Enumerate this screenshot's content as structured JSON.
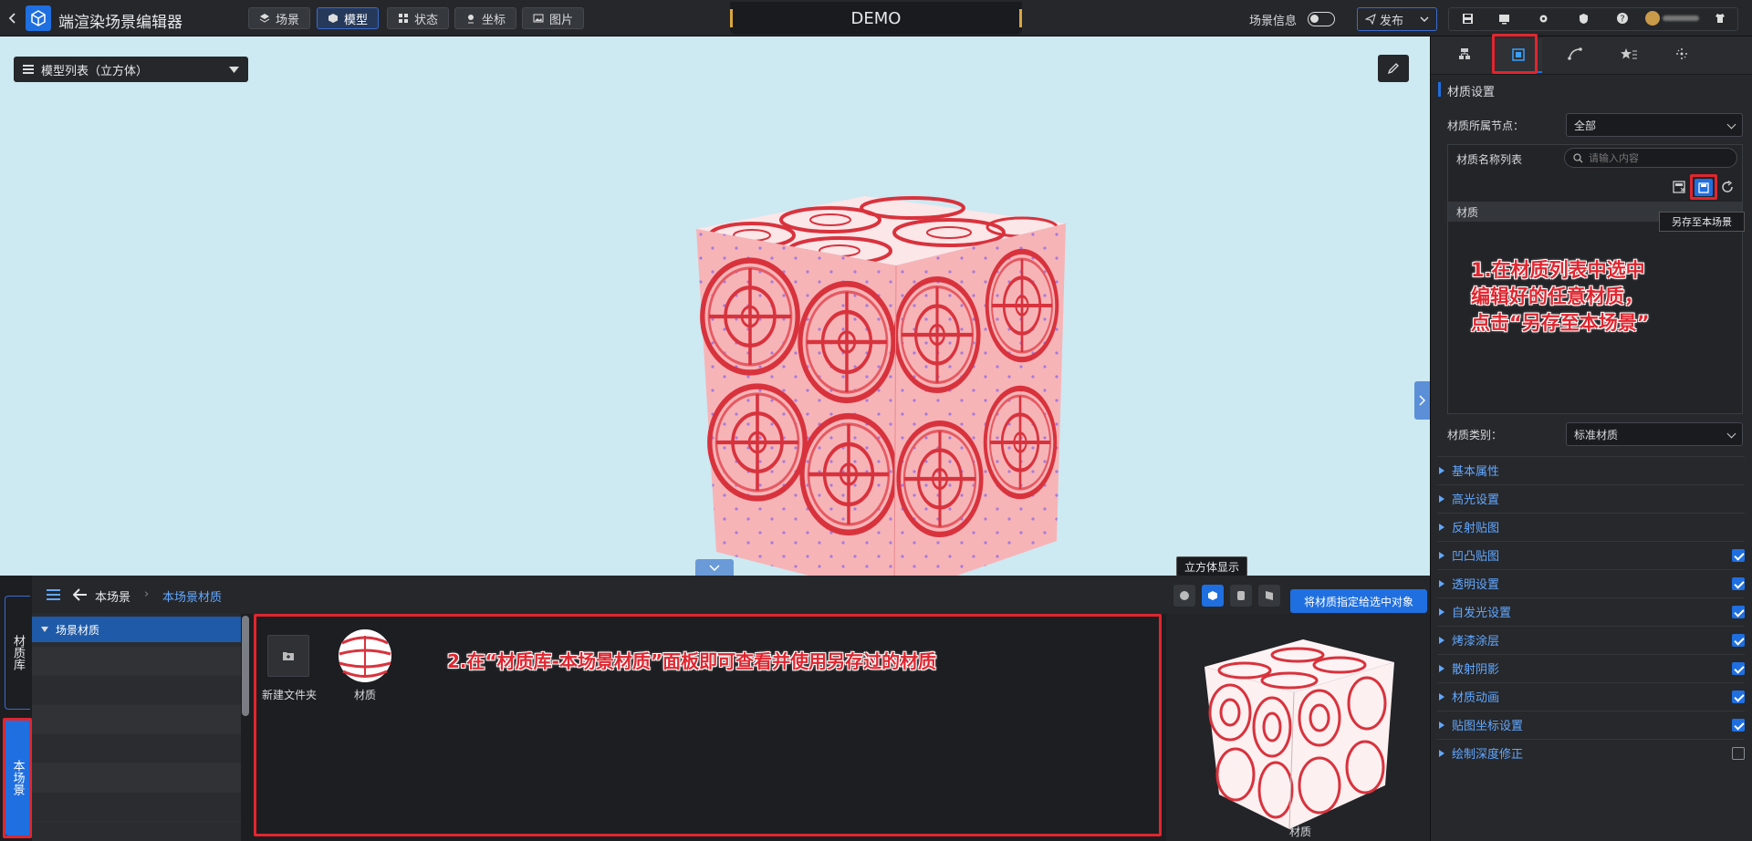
{
  "app": {
    "title": "端渲染场景编辑器",
    "scene_name": "DEMO"
  },
  "top_tabs": [
    {
      "label": "场景",
      "icon": "layers-icon"
    },
    {
      "label": "模型",
      "icon": "cube-icon",
      "active": true
    },
    {
      "label": "状态",
      "icon": "grid-icon"
    },
    {
      "label": "坐标",
      "icon": "pin-icon"
    },
    {
      "label": "图片",
      "icon": "image-icon"
    }
  ],
  "top_right": {
    "scene_info_label": "场景信息",
    "scene_info_on": false,
    "publish_label": "发布"
  },
  "viewport": {
    "model_list_label": "模型列表（立方体）",
    "display_tooltip": "立方体显示"
  },
  "bottom": {
    "breadcrumb_root": "本场景",
    "breadcrumb_current": "本场景材质",
    "left_tabs": [
      "材质库",
      "本场景"
    ],
    "tree_item": "场景材质",
    "tiles": [
      {
        "label": "新建文件夹",
        "icon": "new-folder-icon"
      },
      {
        "label": "材质",
        "icon": "material-ball-icon"
      }
    ],
    "assign_button": "将材质指定给选中对象",
    "preview_label": "材质"
  },
  "right_panel": {
    "section_title": "材质设置",
    "node_label": "材质所属节点：",
    "node_value": "全部",
    "name_list_label": "材质名称列表",
    "search_placeholder": "请输入内容",
    "list_header": "材质",
    "save_tooltip": "另存至本场景",
    "category_label": "材质类别：",
    "category_value": "标准材质",
    "sections": [
      {
        "label": "基本属性",
        "checkbox": null
      },
      {
        "label": "高光设置",
        "checkbox": null
      },
      {
        "label": "反射贴图",
        "checkbox": null
      },
      {
        "label": "凹凸贴图",
        "checkbox": true
      },
      {
        "label": "透明设置",
        "checkbox": true
      },
      {
        "label": "自发光设置",
        "checkbox": true
      },
      {
        "label": "烤漆涂层",
        "checkbox": true
      },
      {
        "label": "散射阴影",
        "checkbox": true
      },
      {
        "label": "材质动画",
        "checkbox": true
      },
      {
        "label": "贴图坐标设置",
        "checkbox": true
      },
      {
        "label": "绘制深度修正",
        "checkbox": false
      }
    ]
  },
  "annotations": {
    "step1": [
      "1.在材质列表中选中",
      "编辑好的任意材质，",
      "点击“另存至本场景”"
    ],
    "step2": "2.在“材质库-本场景材质”面板即可查看并使用另存过的材质"
  },
  "colors": {
    "accent": "#1f6fe0",
    "annotation_red": "#e0262f",
    "viewport_bg": "#cde9f2",
    "panel_bg": "#26282c",
    "cube_pink": "#f7b4b7",
    "cube_line": "#d8333d"
  }
}
